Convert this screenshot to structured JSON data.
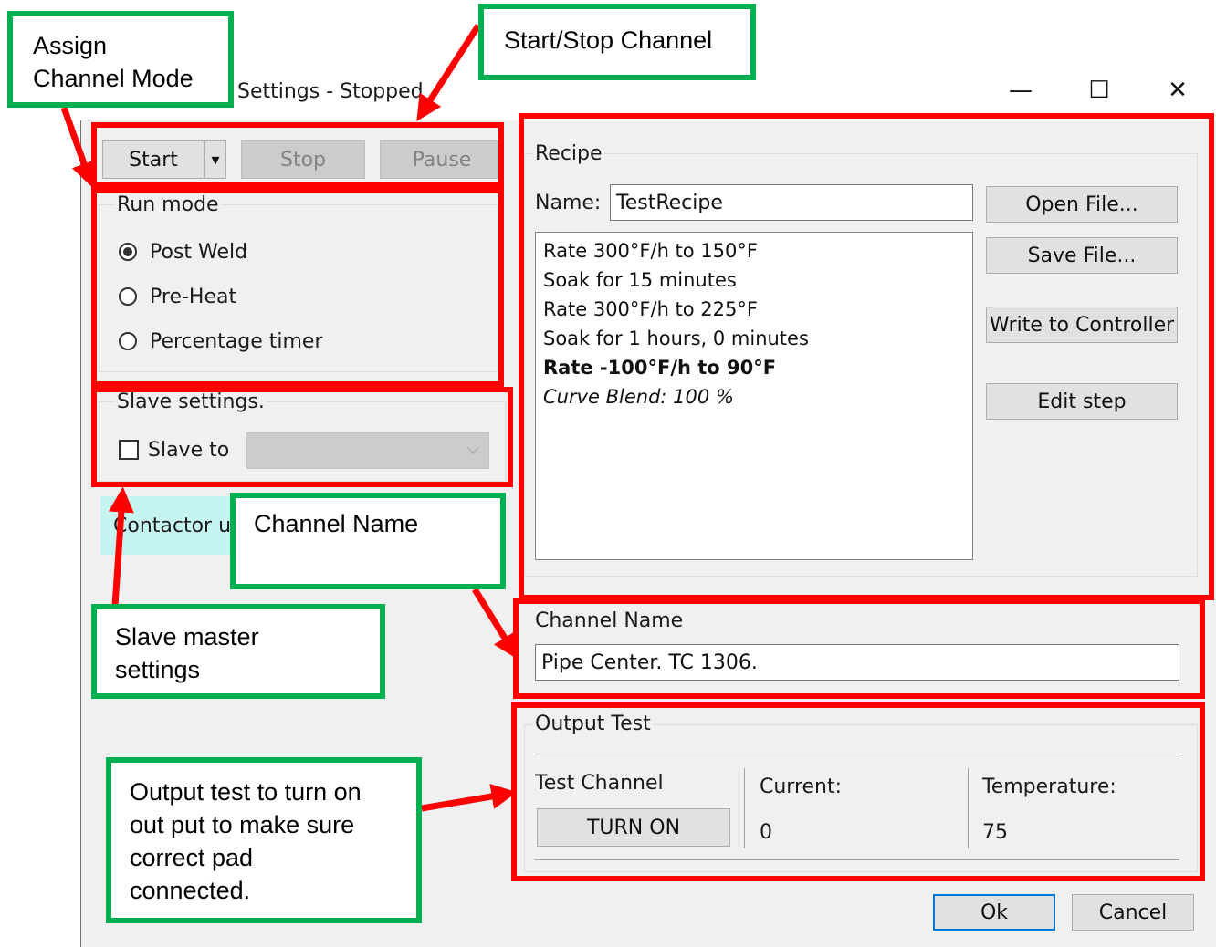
{
  "window": {
    "title": "Settings - Stopped",
    "minimize_glyph": "—",
    "maximize_glyph": "☐",
    "close_glyph": "✕"
  },
  "toolbar": {
    "start_label": "Start",
    "stop_label": "Stop",
    "pause_label": "Pause",
    "dropdown_glyph": "▾"
  },
  "run_mode": {
    "title": "Run mode",
    "options": [
      {
        "label": "Post Weld",
        "selected": true
      },
      {
        "label": "Pre-Heat",
        "selected": false
      },
      {
        "label": "Percentage timer",
        "selected": false
      }
    ]
  },
  "slave_settings": {
    "title": "Slave settings.",
    "checkbox_label": "Slave to",
    "select_value": ""
  },
  "contactor": {
    "label": "Contactor u"
  },
  "recipe": {
    "title": "Recipe",
    "name_label": "Name:",
    "name_value": "TestRecipe",
    "steps": [
      "Rate 300°F/h to 150°F",
      "Soak for 15 minutes",
      "Rate 300°F/h to 225°F",
      "Soak for 1 hours, 0 minutes",
      "Rate -100°F/h to 90°F",
      "Curve Blend: 100 %"
    ],
    "open_file": "Open File...",
    "save_file": "Save File...",
    "write_controller": "Write to Controller",
    "edit_step": "Edit step"
  },
  "channel_name": {
    "title": "Channel Name",
    "value": "Pipe Center. TC 1306."
  },
  "output_test": {
    "title": "Output Test",
    "test_channel_label": "Test Channel",
    "turn_on": "TURN ON",
    "current_label": "Current:",
    "current_value": "0",
    "temperature_label": "Temperature:",
    "temperature_value": "75"
  },
  "footer": {
    "ok": "Ok",
    "cancel": "Cancel"
  },
  "callouts": {
    "assign_mode_line1": "Assign",
    "assign_mode_line2": "Channel Mode",
    "start_stop": "Start/Stop Channel",
    "channel_name": "Channel Name",
    "slave_line1": "Slave master",
    "slave_line2": "settings",
    "output_line1": "Output test to turn on",
    "output_line2": "out put to make sure",
    "output_line3": "correct pad",
    "output_line4": "connected."
  },
  "colors": {
    "highlight_box": "#ff0000",
    "callout_border": "#00b050",
    "contactor_bg": "#c6f5f1"
  }
}
